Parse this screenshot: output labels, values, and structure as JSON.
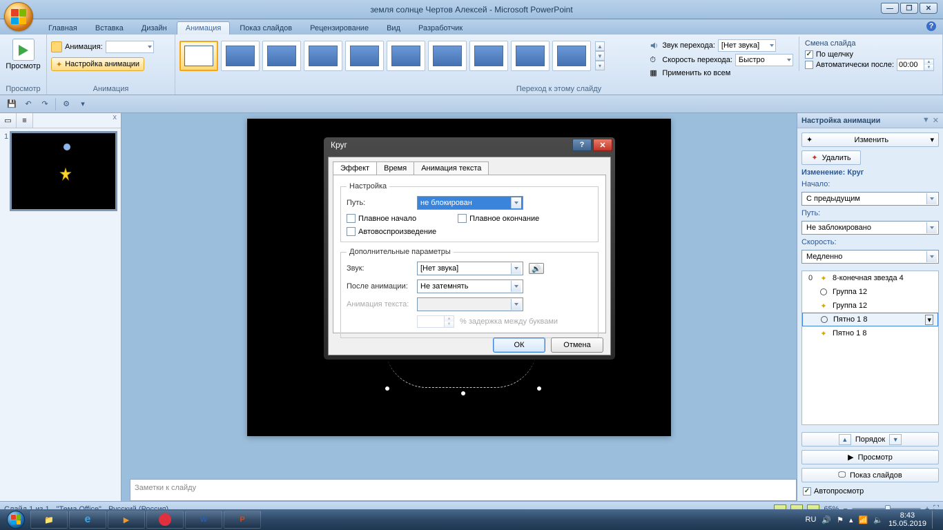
{
  "title": "земля солнце Чертов Алексей - Microsoft PowerPoint",
  "tabs": {
    "home": "Главная",
    "insert": "Вставка",
    "design": "Дизайн",
    "anim": "Анимация",
    "show": "Показ слайдов",
    "review": "Рецензирование",
    "view": "Вид",
    "dev": "Разработчик"
  },
  "ribbon": {
    "preview_label": "Просмотр",
    "preview_group": "Просмотр",
    "anim_label": "Анимация:",
    "custom_anim": "Настройка анимации",
    "anim_group": "Анимация",
    "transition_group": "Переход к этому слайду",
    "sound_label": "Звук перехода:",
    "sound_value": "[Нет звука]",
    "speed_label": "Скорость перехода:",
    "speed_value": "Быстро",
    "apply_all": "Применить ко всем",
    "advance_label": "Смена слайда",
    "on_click": "По щелчку",
    "auto_after": "Автоматически после:",
    "auto_time": "00:00"
  },
  "dialog": {
    "title": "Круг",
    "tabs": {
      "effect": "Эффект",
      "time": "Время",
      "text": "Анимация текста"
    },
    "settings_legend": "Настройка",
    "path_label": "Путь:",
    "path_value": "не блокирован",
    "smooth_start": "Плавное начало",
    "smooth_end": "Плавное окончание",
    "autorev": "Автовоспроизведение",
    "extra_legend": "Дополнительные параметры",
    "sound_label": "Звук:",
    "sound_value": "[Нет звука]",
    "after_label": "После анимации:",
    "after_value": "Не затемнять",
    "text_anim_label": "Анимация текста:",
    "delay_label": "% задержка между буквами",
    "ok": "ОК",
    "cancel": "Отмена"
  },
  "anim_pane": {
    "title": "Настройка анимации",
    "change_btn": "Изменить",
    "delete_btn": "Удалить",
    "sub": "Изменение: Круг",
    "start_label": "Начало:",
    "start_value": "С предыдущим",
    "path_label": "Путь:",
    "path_value": "Не заблокировано",
    "speed_label": "Скорость:",
    "speed_value": "Медленно",
    "items": [
      {
        "ord": "0",
        "name": "8-конечная звезда 4",
        "type": "path"
      },
      {
        "ord": "",
        "name": "Группа 12",
        "type": "emph"
      },
      {
        "ord": "",
        "name": "Группа 12",
        "type": "path"
      },
      {
        "ord": "",
        "name": "Пятно 1 8",
        "type": "emph",
        "sel": true
      },
      {
        "ord": "",
        "name": "Пятно 1 8",
        "type": "path"
      }
    ],
    "reorder": "Порядок",
    "preview": "Просмотр",
    "slideshow": "Показ слайдов",
    "autoprev": "Автопросмотр"
  },
  "notes_placeholder": "Заметки к слайду",
  "status": {
    "slide": "Слайд 1 из 1",
    "theme": "\"Тема Office\"",
    "lang": "Русский (Россия)",
    "zoom": "65%"
  },
  "tray": {
    "lang": "RU",
    "time": "8:43",
    "date": "15.05.2019"
  }
}
